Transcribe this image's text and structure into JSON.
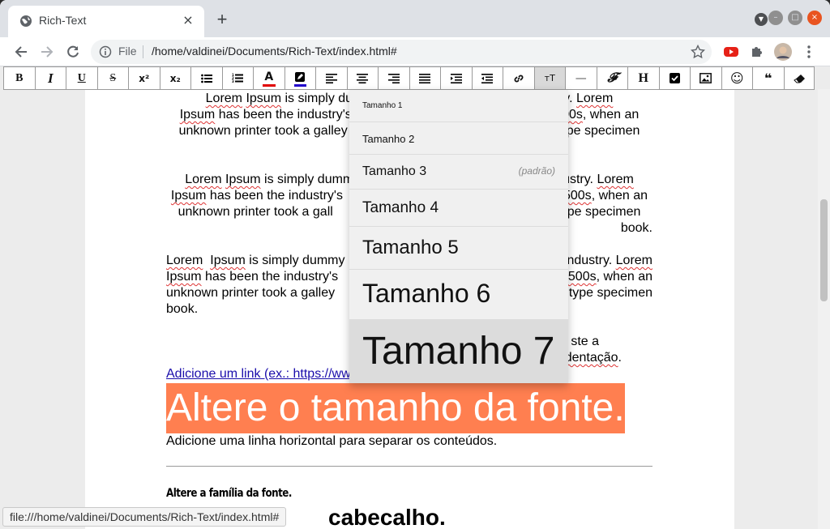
{
  "browser": {
    "tab_title": "Rich-Text",
    "tab_close": "×",
    "new_tab": "+",
    "scheme_label": "File",
    "url": "/home/valdinei/Documents/Rich-Text/index.html#",
    "status_url": "file:///home/valdinei/Documents/Rich-Text/index.html#"
  },
  "editor_toolbar": {
    "buttons": [
      {
        "name": "bold",
        "label": "B"
      },
      {
        "name": "italic",
        "label": "I"
      },
      {
        "name": "underline",
        "label": "U"
      },
      {
        "name": "strikethrough",
        "label": "S"
      },
      {
        "name": "superscript",
        "label": "x²"
      },
      {
        "name": "subscript",
        "label": "x₂"
      },
      {
        "name": "unordered-list",
        "label": ""
      },
      {
        "name": "ordered-list",
        "label": ""
      },
      {
        "name": "font-color",
        "label": "A"
      },
      {
        "name": "highlight-color",
        "label": ""
      },
      {
        "name": "align-left",
        "label": ""
      },
      {
        "name": "align-center",
        "label": ""
      },
      {
        "name": "align-right",
        "label": ""
      },
      {
        "name": "align-justify",
        "label": ""
      },
      {
        "name": "indent",
        "label": ""
      },
      {
        "name": "outdent",
        "label": ""
      },
      {
        "name": "link",
        "label": ""
      },
      {
        "name": "font-size",
        "label": "тT"
      },
      {
        "name": "horizontal-rule",
        "label": "—"
      },
      {
        "name": "font-family",
        "label": "𝓕"
      },
      {
        "name": "heading",
        "label": "H"
      },
      {
        "name": "checkbox",
        "label": ""
      },
      {
        "name": "image",
        "label": ""
      },
      {
        "name": "emoji",
        "label": "☺"
      },
      {
        "name": "quote",
        "label": "❝"
      },
      {
        "name": "eraser",
        "label": ""
      }
    ],
    "colors": {
      "font_color": "#e00000",
      "highlight_color": "#2200cc",
      "active_bg": "#d9d9d9"
    }
  },
  "content": {
    "p1": {
      "line1": [
        "Lorem",
        " ",
        "Ipsum",
        " is simply dummy",
        "dustry. ",
        "Lorem"
      ],
      "line2": [
        "Ipsum",
        " has been the industry's s",
        "500s",
        ", when an"
      ],
      "line3": [
        "unknown printer took a galley",
        "ype specimen"
      ]
    },
    "p2": {
      "line1": [
        "Lorem",
        " ",
        "Ipsum",
        " is simply dumm",
        "ndustry. ",
        "Lorem"
      ],
      "line2": [
        "Ipsum",
        " has been the industry's",
        "500s",
        ", when an"
      ],
      "line3": [
        "unknown printer took a gall",
        " type specimen"
      ],
      "line4": "book."
    },
    "p3": {
      "line1": [
        "Lorem",
        " ",
        "Ipsum",
        " is simply dummy",
        "ndustry. ",
        "Lorem"
      ],
      "line2": [
        "Ipsum",
        " has been the industry's",
        "500s",
        ", when an"
      ],
      "line3": [
        "unknown printer took a galley",
        " type specimen"
      ],
      "line4": "book."
    },
    "p4": {
      "line1": "ste a",
      "line2": "dentação",
      "line2_end": "."
    },
    "link_text": "Adicione um link (ex.: https://ww",
    "big_text": "Altere o tamanho da fonte.",
    "big_bg": "#ff7f50",
    "hr_caption": "Adicione uma linha horizontal para separar os conteúdos.",
    "family_text": "Altere a família da fonte.",
    "heading_text": "cabecalho."
  },
  "font_size_dropdown": {
    "items": [
      {
        "label": "Tamanho 1",
        "note": ""
      },
      {
        "label": "Tamanho 2",
        "note": ""
      },
      {
        "label": "Tamanho 3",
        "note": "(padrão)"
      },
      {
        "label": "Tamanho 4",
        "note": ""
      },
      {
        "label": "Tamanho 5",
        "note": ""
      },
      {
        "label": "Tamanho 6",
        "note": ""
      },
      {
        "label": "Tamanho 7",
        "note": ""
      }
    ],
    "hovered_index": 6
  }
}
